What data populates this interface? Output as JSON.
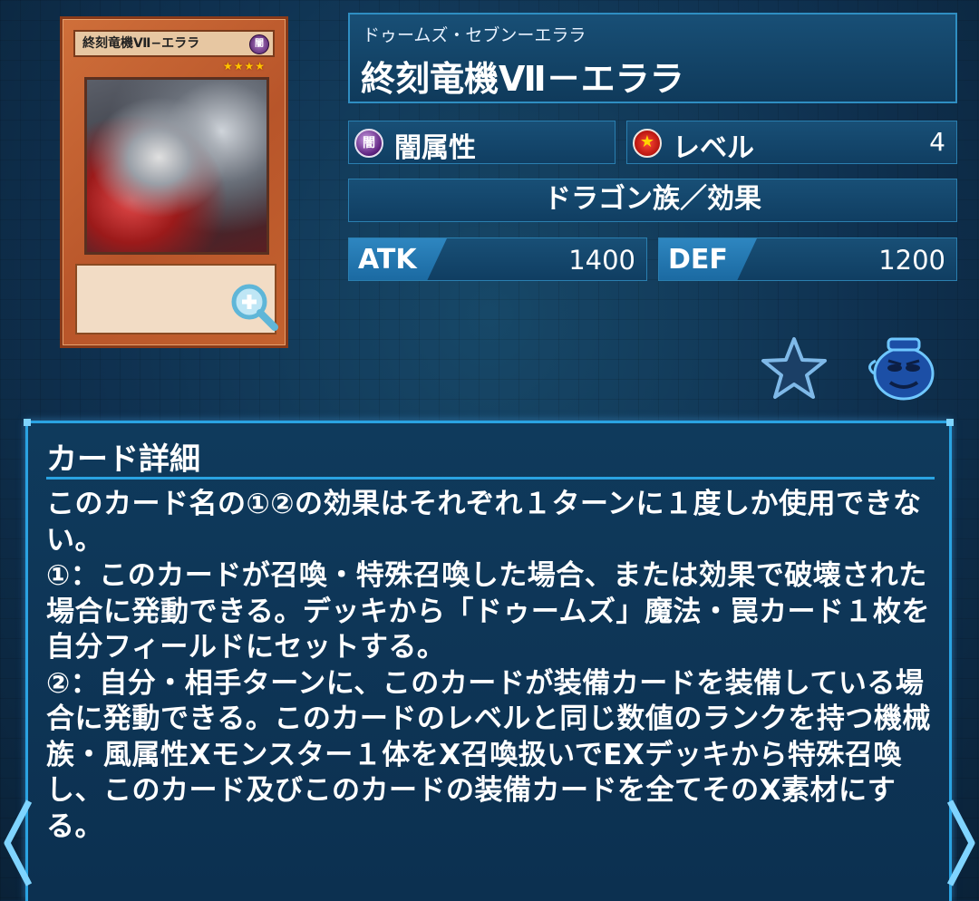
{
  "card": {
    "image_title": "終刻竜機Ⅶ−エララ",
    "image_attribute": "闇",
    "image_stars": "★★★★"
  },
  "header": {
    "ruby": "ドゥームズ・セブンーエララ",
    "name": "終刻竜機Ⅶ－エララ"
  },
  "attribute": {
    "icon": "闇",
    "label": "闇属性"
  },
  "level": {
    "label": "レベル",
    "value": "4"
  },
  "type_line": "ドラゴン族／効果",
  "atk": {
    "label": "ATK",
    "value": "1400"
  },
  "def": {
    "label": "DEF",
    "value": "1200"
  },
  "detail": {
    "title": "カード詳細",
    "text": "このカード名の①②の効果はそれぞれ１ターンに１度しか使用できない。\n①：このカードが召喚・特殊召喚した場合、または効果で破壊された場合に発動できる。デッキから「ドゥームズ」魔法・罠カード１枚を自分フィールドにセットする。\n②：自分・相手ターンに、このカードが装備カードを装備している場合に発動できる。このカードのレベルと同じ数値のランクを持つ機械族・風属性Xモンスター１体をX召喚扱いでEXデッキから特殊召喚し、このカード及びこのカードの装備カードを全てそのX素材にする。"
  },
  "icons": {
    "favorite": "star-icon",
    "deck": "pot-icon",
    "zoom": "magnify-icon",
    "prev": "chevron-left-icon",
    "next": "chevron-right-icon"
  }
}
